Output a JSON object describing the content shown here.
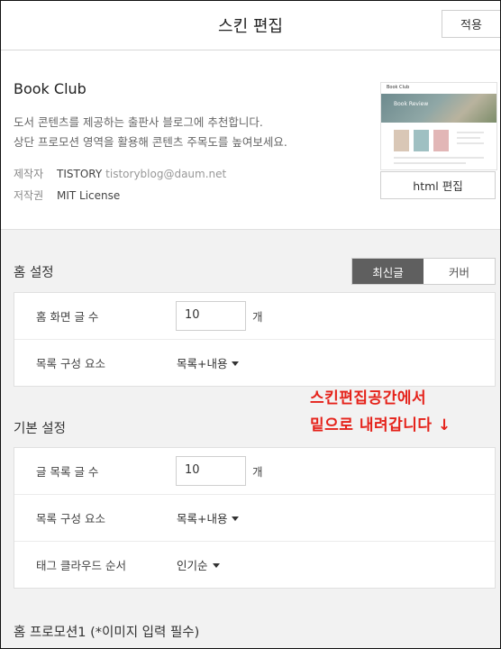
{
  "header": {
    "title": "스킨 편집",
    "apply_label": "적용"
  },
  "skin": {
    "name": "Book Club",
    "description_line1": "도서 콘텐츠를 제공하는 출판사 블로그에 추천합니다.",
    "description_line2": "상단 프로모션 영역을 활용해 콘텐츠 주목도를 높여보세요.",
    "author_label": "제작자",
    "author_name": "TISTORY",
    "author_email": "tistoryblog@daum.net",
    "license_label": "저작권",
    "license_value": "MIT License",
    "thumbnail_title": "Book Club",
    "thumbnail_hero_text": "Book Review",
    "html_edit_label": "html 편집"
  },
  "home_settings": {
    "title": "홈 설정",
    "toggle": [
      "최신글",
      "커버"
    ],
    "active_toggle": "최신글",
    "rows": [
      {
        "label": "홈 화면 글 수",
        "value": "10",
        "unit": "개"
      },
      {
        "label": "목록 구성 요소",
        "value": "목록+내용"
      }
    ]
  },
  "basic_settings": {
    "title": "기본 설정",
    "rows": [
      {
        "label": "글 목록 글 수",
        "value": "10",
        "unit": "개"
      },
      {
        "label": "목록 구성 요소",
        "value": "목록+내용"
      },
      {
        "label": "태그 클라우드 순서",
        "value": "인기순"
      }
    ]
  },
  "promotion": {
    "title": "홈 프로모션1 (*이미지 입력 필수)"
  },
  "annotation": {
    "line1": "스킨편집공간에서",
    "line2": "밑으로 내려갑니다 ↓"
  },
  "colors": {
    "annotation": "#e5221a",
    "toggle_active": "#5f5f5f"
  }
}
